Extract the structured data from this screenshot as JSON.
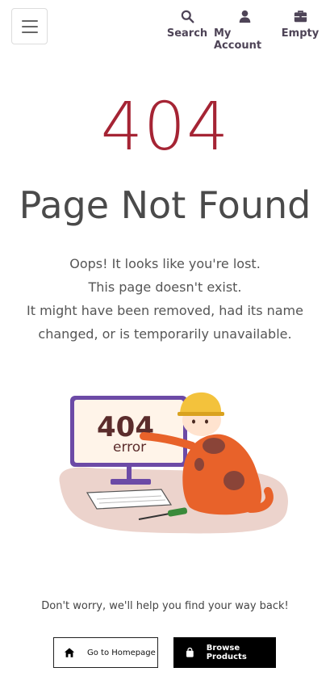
{
  "header": {
    "search_label": "Search",
    "account_label": "My Account",
    "cart_label": "Empty"
  },
  "main": {
    "error_code": "404",
    "title": "Page Not Found",
    "message_lines": [
      "Oops! It looks like you're lost.",
      "This page doesn't exist.",
      "It might have been removed, had its name",
      "changed, or is temporarily unavailable."
    ],
    "illustration": {
      "screen_code": "404",
      "screen_text": "error"
    },
    "help_text": "Don't worry, we'll help you find your way back!"
  },
  "actions": {
    "home_label": "Go to Homepage",
    "browse_label": "Browse Products"
  },
  "colors": {
    "accent": "#a52434",
    "nav_text": "#4e4457",
    "cat_orange": "#e8622a",
    "helmet_yellow": "#f3c23c",
    "monitor_purple": "#6c4aa6"
  },
  "icons": {
    "menu": "hamburger-icon",
    "search": "search-icon",
    "account": "user-icon",
    "cart": "briefcase-icon",
    "home": "home-icon",
    "browse": "shopping-bag-icon"
  }
}
